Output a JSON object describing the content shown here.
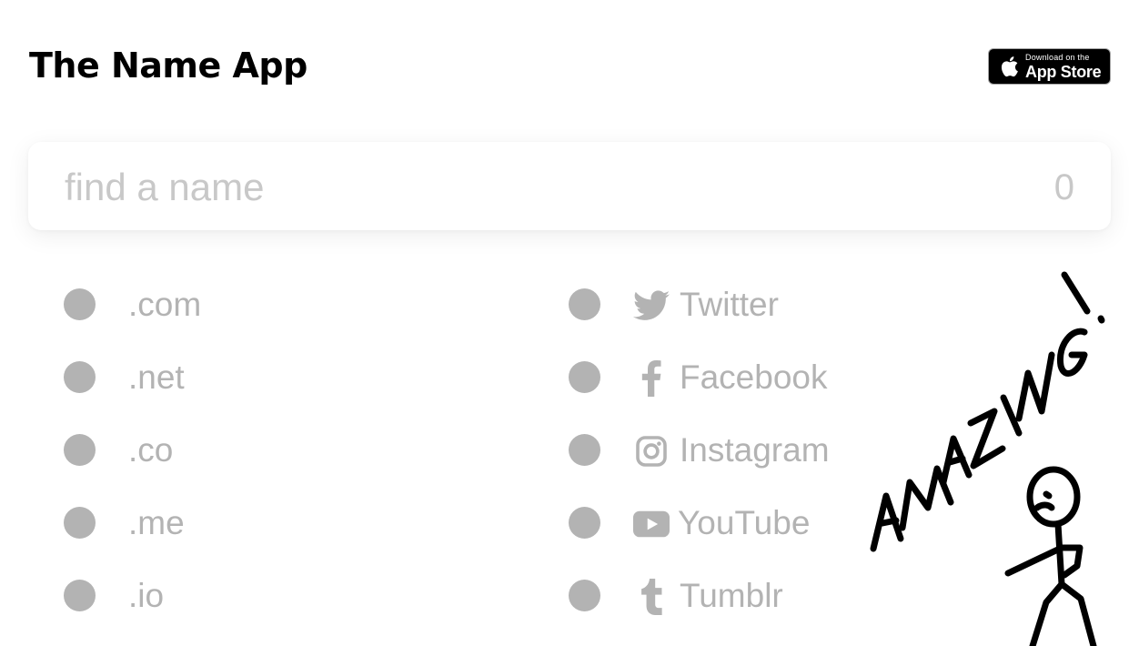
{
  "header": {
    "title": "The Name App",
    "appstore": {
      "small_label": "Download on the",
      "big_label": "App Store"
    }
  },
  "search": {
    "placeholder": "find a name",
    "value": "",
    "char_count": "0"
  },
  "domains": [
    {
      "label": ".com"
    },
    {
      "label": ".net"
    },
    {
      "label": ".co"
    },
    {
      "label": ".me"
    },
    {
      "label": ".io"
    }
  ],
  "socials": [
    {
      "label": "Twitter",
      "icon": "twitter-icon"
    },
    {
      "label": "Facebook",
      "icon": "facebook-icon"
    },
    {
      "label": "Instagram",
      "icon": "instagram-icon"
    },
    {
      "label": "YouTube",
      "icon": "youtube-icon"
    },
    {
      "label": "Tumblr",
      "icon": "tumblr-icon"
    }
  ],
  "doodle": {
    "text": "AMAZING!"
  },
  "colors": {
    "status_dot": "#b3b3b3",
    "muted_text": "#b3b3b3",
    "placeholder": "#c8c8c8"
  }
}
